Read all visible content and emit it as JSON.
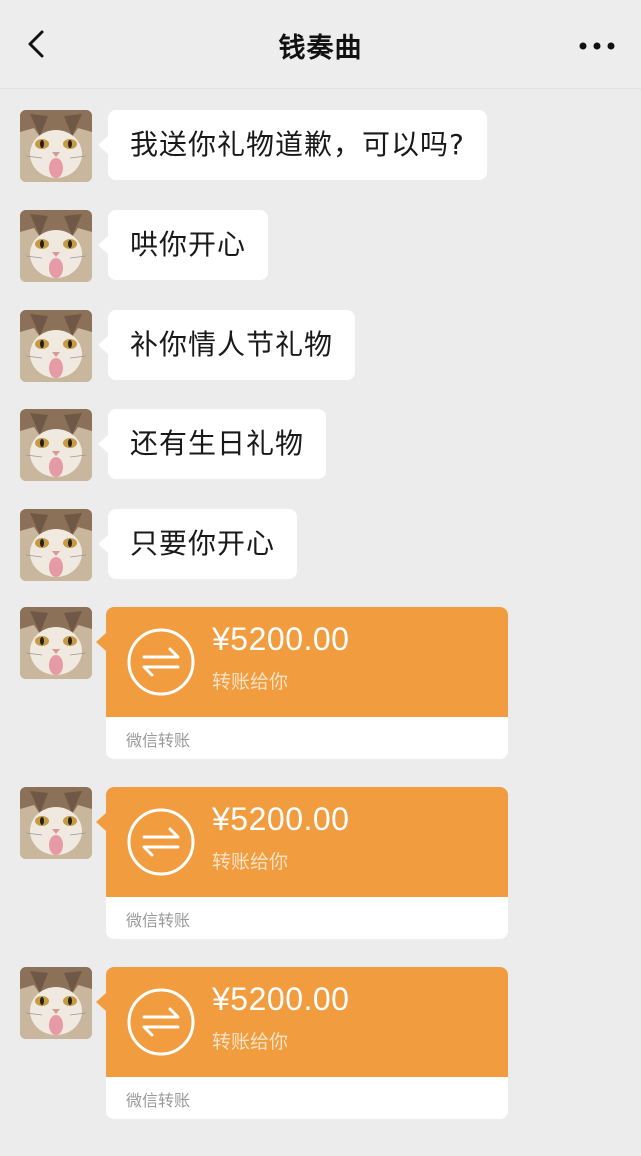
{
  "header": {
    "title": "钱奏曲"
  },
  "messages": [
    {
      "text": "我送你礼物道歉，可以吗?"
    },
    {
      "text": "哄你开心"
    },
    {
      "text": "补你情人节礼物"
    },
    {
      "text": "还有生日礼物"
    },
    {
      "text": "只要你开心"
    }
  ],
  "transfers": [
    {
      "amount": "¥5200.00",
      "subtitle": "转账给你",
      "footer": "微信转账"
    },
    {
      "amount": "¥5200.00",
      "subtitle": "转账给你",
      "footer": "微信转账"
    },
    {
      "amount": "¥5200.00",
      "subtitle": "转账给你",
      "footer": "微信转账"
    }
  ],
  "icons": {
    "back": "chevron-left-icon",
    "more": "more-horizontal-icon",
    "transfer": "transfer-arrows-icon"
  },
  "colors": {
    "background": "#ececec",
    "bubble": "#ffffff",
    "transfer_orange": "#f19c3f"
  }
}
